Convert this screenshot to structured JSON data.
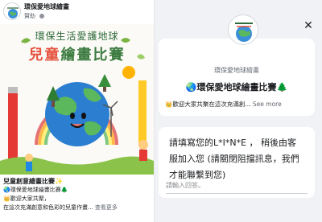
{
  "post": {
    "page_name": "環保愛地球繪畫",
    "sponsored": "贊助",
    "ad": {
      "title_line1": "環保生活愛護地球",
      "title_line2_red": "兒童",
      "title_line2_green": "繪畫比賽"
    },
    "title": "兒童創意繪畫比賽✨",
    "lines": [
      "🌏環保愛地球繪畫比賽🌲",
      "👑歡迎大家共聚，",
      "在這次充滿創意和色彩的兒童作畫..."
    ],
    "see_more": "查看更多"
  },
  "panel": {
    "close_icon": "✕",
    "profile_name": "環保愛地球繪畫",
    "profile_title": "🌏環保愛地球繪畫比賽🌲",
    "profile_desc": "👑歡迎大家共聚在這次充滿創...",
    "see_more": "See more",
    "question_lines": [
      "請填寫您的L*I*N*E ， 稍後由客",
      "服加入您 (請關閉阻擋訊息，我們",
      "才能聯繫到您)"
    ],
    "answer_placeholder": "請輸入回答。"
  },
  "colors": {
    "title_green": "#3a7a3e",
    "title_red": "#e6513e",
    "globe_blue": "#2c7fd0",
    "panel_bg": "#f0f2f5"
  }
}
